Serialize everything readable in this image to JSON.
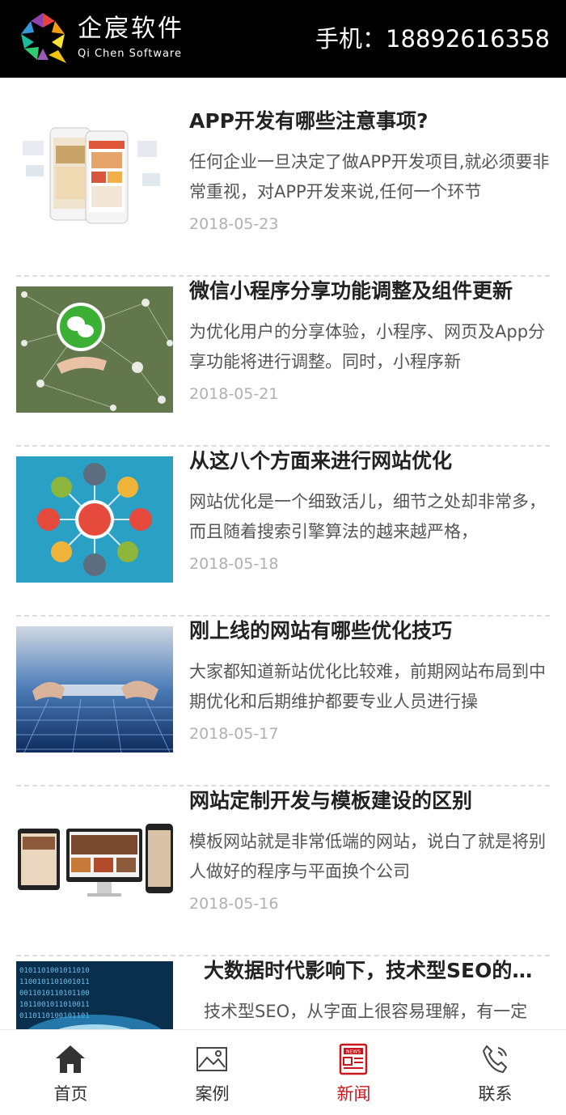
{
  "header": {
    "brand_cn": "企宸软件",
    "brand_en": "Qi Chen Software",
    "phone": "手机：18892616358"
  },
  "articles": [
    {
      "title": "APP开发有哪些注意事项?",
      "desc": "任何企业一旦决定了做APP开发项目,就必须要非常重视，对APP开发来说,任何一个环节",
      "date": "2018-05-23",
      "image": "app-phones-image"
    },
    {
      "title": "微信小程序分享功能调整及组件更新",
      "desc": "为优化用户的分享体验，小程序、网页及App分享功能将进行调整。同时，小程序新",
      "date": "2018-05-21",
      "image": "wechat-network-image"
    },
    {
      "title": "从这八个方面来进行网站优化",
      "desc": "网站优化是一个细致活儿，细节之处却非常多，而且随着搜索引擎算法的越来越严格，",
      "date": "2018-05-18",
      "image": "seo-diagram-image"
    },
    {
      "title": "刚上线的网站有哪些优化技巧",
      "desc": "大家都知道新站优化比较难，前期网站布局到中期优化和后期维护都要专业人员进行操",
      "date": "2018-05-17",
      "image": "seo-keyboard-image"
    },
    {
      "title": "网站定制开发与模板建设的区别",
      "desc": "模板网站就是非常低端的网站，说白了就是将别人做好的程序与平面换个公司",
      "date": "2018-05-16",
      "image": "devices-image"
    },
    {
      "title": "大数据时代影响下，技术型SEO的…",
      "desc": "技术型SEO，从字面上很容易理解，有一定",
      "date": "",
      "image": "big-data-image"
    }
  ],
  "tabbar": [
    {
      "label": "首页",
      "icon": "home-icon",
      "active": false
    },
    {
      "label": "案例",
      "icon": "image-icon",
      "active": false
    },
    {
      "label": "新闻",
      "icon": "news-icon",
      "active": true
    },
    {
      "label": "联系",
      "icon": "phone-icon",
      "active": false
    }
  ],
  "colors": {
    "header_bg": "#000000",
    "accent": "#c8161d",
    "date": "#b0b0b0"
  }
}
